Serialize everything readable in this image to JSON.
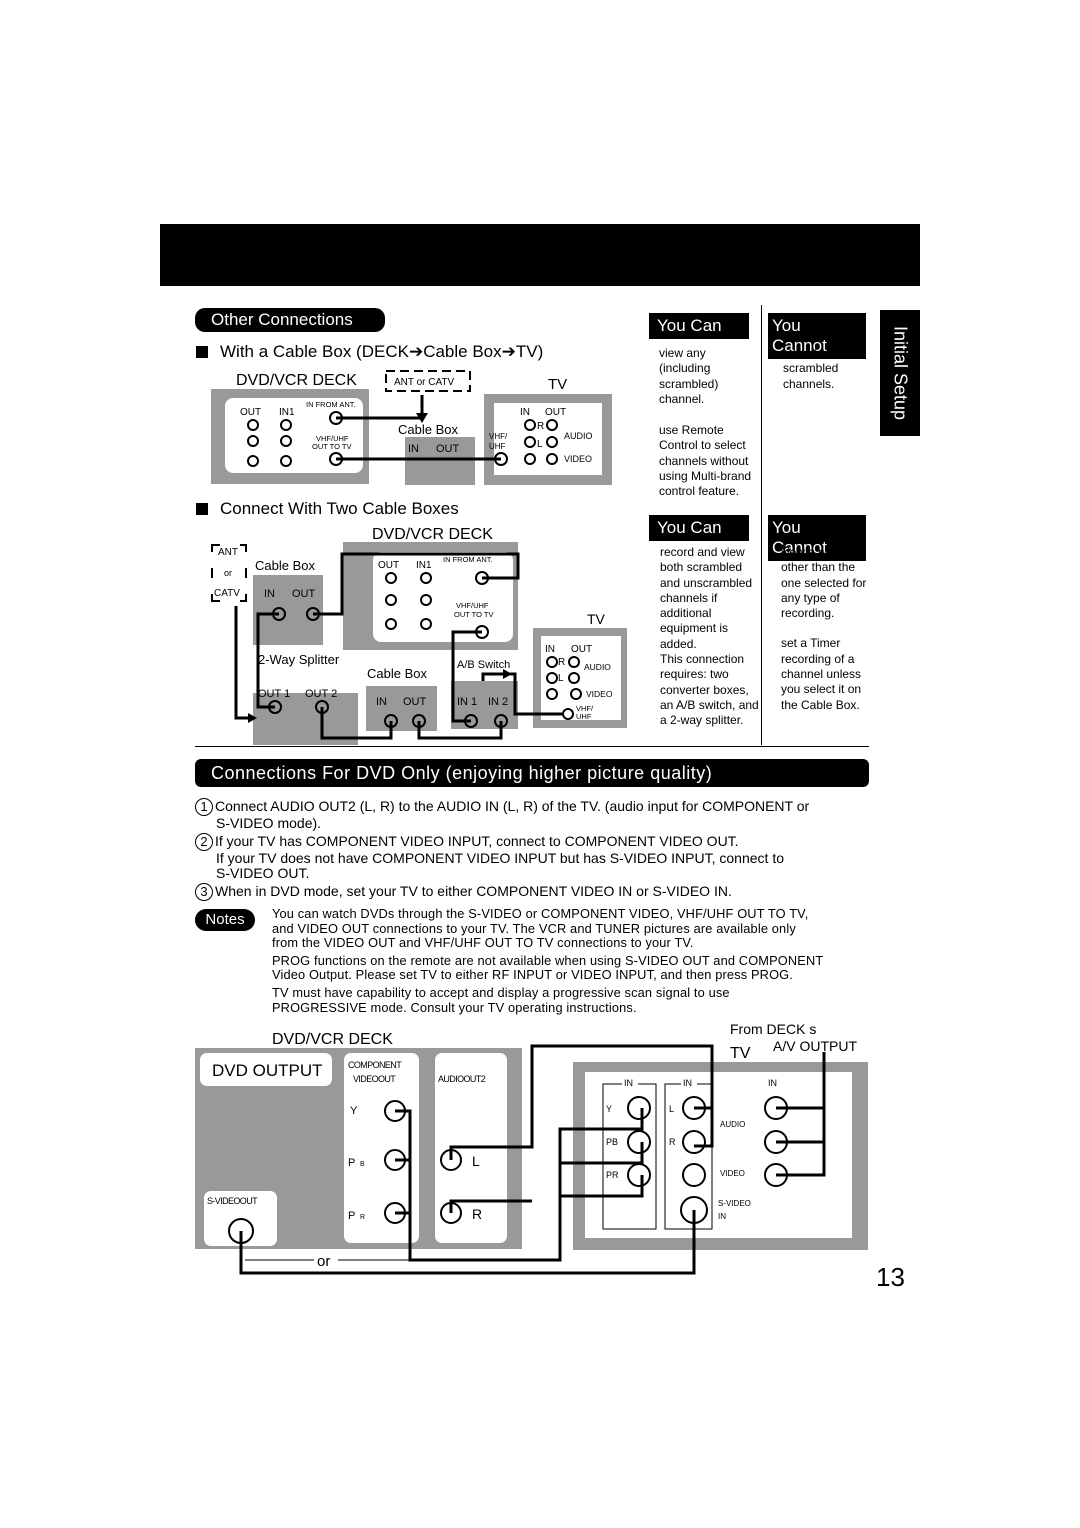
{
  "header": {
    "title": ""
  },
  "side_tab": {
    "label": "Initial Setup"
  },
  "other_connections": {
    "pill_label": "Other Connections",
    "cable_box_section": {
      "heading": "With a Cable Box (DECK➔Cable Box➔TV)",
      "diagram": {
        "deck_label": "DVD/VCR DECK",
        "ant_label": "ANT or CATV",
        "tv_label": "TV",
        "deck_ports": {
          "out": "OUT",
          "in1": "IN1",
          "in_from_ant": "IN FROM ANT.",
          "vhf_uhf_out": [
            "VHF/UHF",
            "OUT TO TV"
          ]
        },
        "cable_box": {
          "label": "Cable  Box",
          "in": "IN",
          "out": "OUT"
        },
        "tv_ports": {
          "in": "IN",
          "out": "OUT",
          "r": "R",
          "l": "L",
          "audio": "AUDIO",
          "video": "VIDEO",
          "vhf_uhf": [
            "VHF/",
            "UHF"
          ]
        }
      },
      "you_can": {
        "label": "You Can",
        "items": [
          "view any (including scrambled) channel.",
          "use Remote Control to select channels without using Multi-brand control feature."
        ]
      },
      "you_cannot": {
        "label": "You Cannot",
        "items": [
          "record scrambled channels."
        ]
      }
    },
    "two_boxes_section": {
      "heading": "Connect With Two Cable Boxes",
      "diagram": {
        "deck_label": "DVD/VCR DECK",
        "ant_label": [
          "ANT",
          "or",
          "CATV"
        ],
        "tv_label": "TV",
        "cable_box_1": {
          "label": "Cable  Box",
          "in": "IN",
          "out": "OUT"
        },
        "cable_box_2": {
          "label": "Cable  Box",
          "in": "IN",
          "out": "OUT"
        },
        "splitter": {
          "label": "2-Way  Splitter",
          "out1": "OUT 1",
          "out2": "OUT 2"
        },
        "ab_switch": {
          "label": "A/B  Switch",
          "in1": "IN 1",
          "in2": "IN 2"
        },
        "deck_ports": {
          "out": "OUT",
          "in1": "IN1",
          "in_from_ant": "IN FROM ANT.",
          "vhf_uhf_out": [
            "VHF/UHF",
            "OUT TO TV"
          ]
        },
        "tv_ports": {
          "in": "IN",
          "out": "OUT",
          "r": "R",
          "l": "L",
          "audio": "AUDIO",
          "video": "VIDEO",
          "vhf_uhf": [
            "VHF/",
            "UHF"
          ]
        }
      },
      "you_can": {
        "label": "You Can",
        "items": [
          "record and view both scrambled and unscrambled channels if additional equipment is added.",
          "This connection requires: two converter boxes, an A/B switch, and a 2-way splitter."
        ]
      },
      "you_cannot": {
        "label": "You Cannot",
        "items": [
          "view a channel other than the one selected for any type of recording.",
          "set a Timer recording of a channel unless you select it on the Cable Box."
        ]
      }
    }
  },
  "dvd_only": {
    "banner": "Connections For DVD Only (enjoying higher picture quality)",
    "steps": [
      {
        "num": "1",
        "lines": [
          "Connect AUDIO OUT2 (L, R) to the AUDIO IN (L, R) of the TV. (audio input for COMPONENT or",
          "S-VIDEO mode)."
        ]
      },
      {
        "num": "2",
        "lines": [
          "If your TV has COMPONENT VIDEO INPUT, connect to COMPONENT VIDEO OUT.",
          "If your TV does not have COMPONENT VIDEO INPUT but has S-VIDEO INPUT, connect to",
          "S-VIDEO OUT."
        ]
      },
      {
        "num": "3",
        "lines": [
          "When in DVD mode, set your TV to either COMPONENT VIDEO IN or S-VIDEO IN."
        ]
      }
    ],
    "notes_label": "Notes",
    "notes": [
      [
        "You can watch DVDs through the S-VIDEO or COMPONENT VIDEO, VHF/UHF OUT TO TV,",
        "and VIDEO OUT connections to your TV. The VCR and TUNER pictures are available only",
        "from the VIDEO OUT and VHF/UHF OUT TO TV connections to your TV."
      ],
      [
        "PROG functions on the remote are not available when using S-VIDEO OUT and COMPONENT",
        "Video Output. Please set TV to either RF INPUT or VIDEO INPUT, and then press PROG."
      ],
      [
        "TV must have capability to accept and display a progressive scan signal to use",
        "PROGRESSIVE mode. Consult your TV operating instructions."
      ]
    ],
    "diagram": {
      "deck_label": "DVD/VCR DECK",
      "dvd_output": "DVD OUTPUT",
      "component_label": [
        "COMPONENT",
        "VIDEOOUT"
      ],
      "audio_out2": "AUDIOOUT2",
      "svideo_out": "S-VIDEOOUT",
      "y": "Y",
      "pb": "P",
      "pb_sub": "B",
      "pr": "P",
      "pr_sub": "R",
      "l": "L",
      "r": "R",
      "or": "or",
      "tv_label": "TV",
      "from_deck": [
        "From DECK s",
        "A/V OUTPUT"
      ],
      "tv_in": "IN",
      "tv_y": "Y",
      "tv_pb": "PB",
      "tv_pr": "PR",
      "tv_l": "L",
      "tv_r": "R",
      "tv_audio": "AUDIO",
      "tv_video": "VIDEO",
      "tv_svideo": [
        "S-VIDEO",
        "IN"
      ]
    }
  },
  "page_number": "13",
  "colors": {
    "panel_gray": "#999999",
    "black": "#000000"
  }
}
